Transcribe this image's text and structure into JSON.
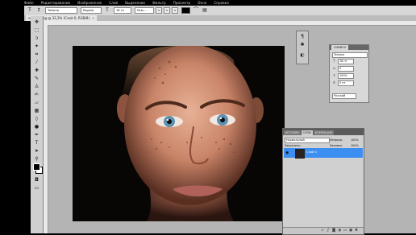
{
  "menu": [
    "Файл",
    "Редактирование",
    "Изображение",
    "Слой",
    "Выделение",
    "Фильтр",
    "Просмотр",
    "Окно",
    "Справка"
  ],
  "options_bar": {
    "font_family": "Tahoma",
    "font_style": "Regular",
    "font_size": "18 пт",
    "antialias": "Резк..."
  },
  "document_tab": {
    "title": "sadbluo.jpg @ 33,3% (Слой 0, RGB/8)",
    "close": "×"
  },
  "character_panel": {
    "tab_label": "СИМВОЛ",
    "font": "Tahoma",
    "size": "18 пт",
    "tracking": "0",
    "scale": "100%",
    "baseline": "0 пт",
    "language": "Русский"
  },
  "layers_panel": {
    "tabs": [
      "ИСТОРИЯ",
      "СЛОИ",
      "КОРРЕКЦИЯ"
    ],
    "active_tab": "СЛОИ",
    "blend_mode": "Нормальный",
    "opacity_label": "Непрозр:",
    "opacity_value": "100%",
    "lock_label": "Закрепить:",
    "fill_label": "Заливка:",
    "fill_value": "100%",
    "layer_name": "Слой 0"
  },
  "icons": {
    "move": "move-icon",
    "marquee": "marquee-icon",
    "lasso": "lasso-icon",
    "brush": "brush-icon",
    "type": "type-icon",
    "zoom": "zoom-icon"
  }
}
